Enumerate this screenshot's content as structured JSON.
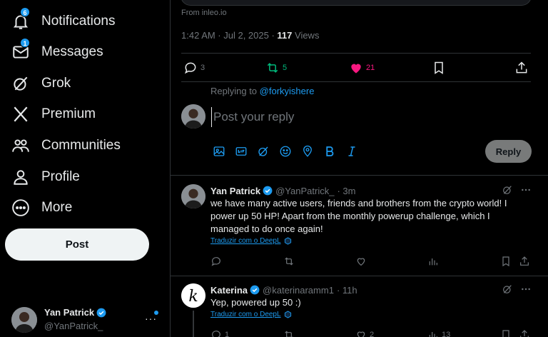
{
  "sidebar": {
    "items": [
      {
        "label": "Notifications",
        "icon": "bell-icon",
        "badge": "6"
      },
      {
        "label": "Messages",
        "icon": "envelope-icon",
        "badge": "1"
      },
      {
        "label": "Grok",
        "icon": "grok-icon"
      },
      {
        "label": "Premium",
        "icon": "x-logo-icon"
      },
      {
        "label": "Communities",
        "icon": "people-icon"
      },
      {
        "label": "Profile",
        "icon": "person-icon"
      },
      {
        "label": "More",
        "icon": "more-circle-icon"
      }
    ],
    "post_label": "Post",
    "account": {
      "name": "Yan Patrick",
      "handle": "@YanPatrick_",
      "more": "···"
    }
  },
  "tweet": {
    "from": "From inleo.io",
    "time": "1:42 AM · Jul 2, 2025 · ",
    "views_count": "117",
    "views_label": " Views",
    "actions": {
      "replies": "3",
      "reposts": "5",
      "likes": "21"
    }
  },
  "composer": {
    "replying_prefix": "Replying to ",
    "replying_handle": "@forkyishere",
    "placeholder": "Post your reply",
    "reply_label": "Reply"
  },
  "replies": [
    {
      "name": "Yan Patrick",
      "handle": "@YanPatrick_",
      "time": "· 3m",
      "text": "we have many active users, friends and brothers from the crypto world! I power up 50 HP! Apart from the monthly powerup challenge, which I managed to do once again!",
      "translate": "Traduzir com o DeepL"
    },
    {
      "name": "Katerina",
      "handle": "@katerinaramm1",
      "time": "· 11h",
      "text": "Yep, powered up 50 :)",
      "translate": "Traduzir com o DeepL",
      "actions": {
        "replies": "1",
        "reposts": "",
        "likes": "2",
        "views": "13"
      }
    }
  ],
  "colors": {
    "accent": "#1d9bf0",
    "repost": "#00ba7c",
    "like": "#f91880",
    "muted": "#71767b",
    "border": "#2f3336"
  }
}
